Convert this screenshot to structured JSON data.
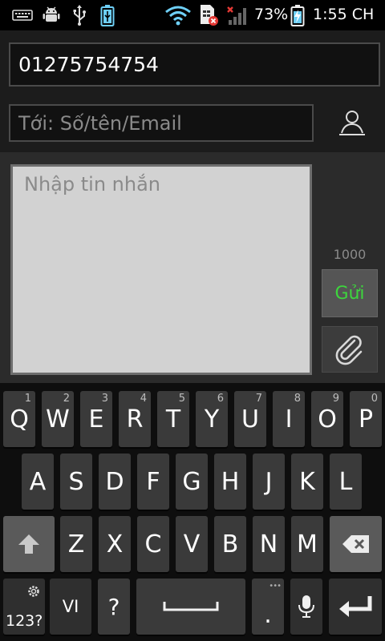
{
  "status_bar": {
    "battery_percent": "73%",
    "time": "1:55 CH",
    "icons": [
      "keyboard-icon",
      "android-debug-icon",
      "usb-icon",
      "battery-small-icon",
      "wifi-icon",
      "sim-error-icon",
      "signal-icon",
      "charging-battery-icon"
    ]
  },
  "compose": {
    "phone_value": "01275754754",
    "recipient_placeholder": "Tới: Số/tên/Email",
    "contact_icon": "person-icon"
  },
  "message": {
    "placeholder": "Nhập tin nhắn",
    "char_counter": "1000",
    "send_label": "Gửi",
    "attach_icon": "paperclip-icon"
  },
  "keyboard": {
    "row1": [
      {
        "key": "Q",
        "num": "1"
      },
      {
        "key": "W",
        "num": "2"
      },
      {
        "key": "E",
        "num": "3"
      },
      {
        "key": "R",
        "num": "4"
      },
      {
        "key": "T",
        "num": "5"
      },
      {
        "key": "Y",
        "num": "6"
      },
      {
        "key": "U",
        "num": "7"
      },
      {
        "key": "I",
        "num": "8"
      },
      {
        "key": "O",
        "num": "9"
      },
      {
        "key": "P",
        "num": "0"
      }
    ],
    "row2": [
      "A",
      "S",
      "D",
      "F",
      "G",
      "H",
      "J",
      "K",
      "L"
    ],
    "row3": [
      "Z",
      "X",
      "C",
      "V",
      "B",
      "N",
      "M"
    ],
    "mode_label": "123?",
    "lang_label": "VI",
    "question_label": "?",
    "period_label": "."
  },
  "colors": {
    "send_text": "#3dd63d",
    "background": "#000000",
    "key": "#3a3a3a"
  }
}
